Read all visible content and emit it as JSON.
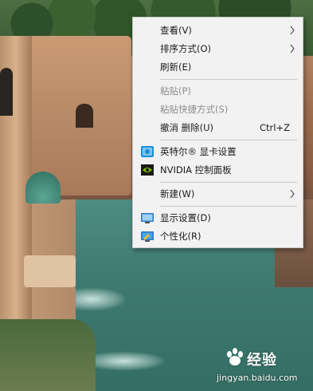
{
  "menu": {
    "items": [
      {
        "label": "查看(V)",
        "submenu": true
      },
      {
        "label": "排序方式(O)",
        "submenu": true
      },
      {
        "label": "刷新(E)"
      },
      {
        "label": "粘贴(P)",
        "disabled": true
      },
      {
        "label": "粘贴快捷方式(S)",
        "disabled": true
      },
      {
        "label": "撤消 删除(U)",
        "shortcut": "Ctrl+Z"
      },
      {
        "label": "英特尔® 显卡设置",
        "icon": "intel-graphics-icon"
      },
      {
        "label": "NVIDIA 控制面板",
        "icon": "nvidia-icon"
      },
      {
        "label": "新建(W)",
        "submenu": true
      },
      {
        "label": "显示设置(D)",
        "icon": "display-settings-icon"
      },
      {
        "label": "个性化(R)",
        "icon": "personalize-icon"
      }
    ]
  },
  "watermark": {
    "brand": "经验",
    "url": "jingyan.baidu.com"
  },
  "colors": {
    "menu_bg": "#f2f2f2",
    "disabled_text": "#8d8d8d",
    "separator": "#c8c8c8",
    "nvidia_green": "#76b900",
    "intel_blue": "#1f8fd6"
  }
}
